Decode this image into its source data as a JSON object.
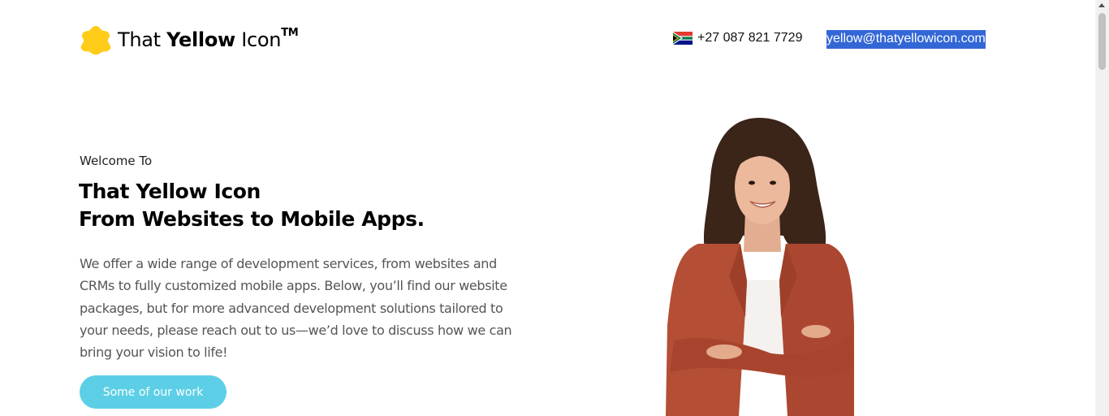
{
  "header": {
    "logo": {
      "text_regular": "That ",
      "text_bold": "Yellow",
      "text_after": " Icon",
      "trademark": "TM",
      "icon": "yellow-blob-icon",
      "color": "#FFCC1A"
    },
    "phone": {
      "flag_icon": "south-africa-flag-icon",
      "number": "+27 087 821 7729"
    },
    "email": "yellow@thatyellowicon.com"
  },
  "hero": {
    "eyebrow": "Welcome To",
    "headline_line1": "That Yellow Icon",
    "headline_line2": "From Websites to Mobile Apps.",
    "description": "We offer a wide range of development services, from websites and CRMs to fully customized mobile apps. Below, you’ll find our website packages, but for more advanced development solutions tailored to your needs, please reach out to us—we’d love to discuss how we can bring your vision to life!",
    "cta_label": "Some of our work",
    "cta_color": "#5CCFE6",
    "portrait": "woman-in-rust-blazer-portrait"
  },
  "colors": {
    "selection": "#3367D6",
    "body_text": "#555555"
  }
}
